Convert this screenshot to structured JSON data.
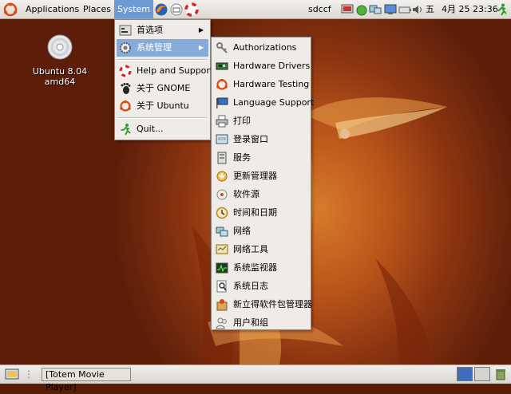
{
  "desktop": {
    "icon_label": "Ubuntu 8.04 amd64"
  },
  "top_panel": {
    "menus": [
      "Applications",
      "Places",
      "System"
    ],
    "username": "sdccf",
    "clock": {
      "weekday": "五",
      "date": "4月 25",
      "time": "23:36"
    }
  },
  "system_menu": {
    "items": [
      {
        "label": "首选项",
        "icon": "preferences-icon",
        "submenu": true
      },
      {
        "label": "系统管理",
        "icon": "gear-icon",
        "submenu": true
      },
      {
        "label": "Help and Support",
        "icon": "help-lifebuoy-icon"
      },
      {
        "label": "关于 GNOME",
        "icon": "gnome-foot-icon"
      },
      {
        "label": "关于 Ubuntu",
        "icon": "ubuntu-logo-icon"
      },
      {
        "label": "Quit...",
        "icon": "quit-running-man-icon"
      }
    ]
  },
  "admin_submenu": {
    "items": [
      {
        "label": "Authorizations",
        "icon": "keys-icon"
      },
      {
        "label": "Hardware Drivers",
        "icon": "hardware-card-icon"
      },
      {
        "label": "Hardware Testing",
        "icon": "ubuntu-logo-icon"
      },
      {
        "label": "Language Support",
        "icon": "flag-icon"
      },
      {
        "label": "打印",
        "icon": "printer-icon"
      },
      {
        "label": "登录窗口",
        "icon": "login-window-icon"
      },
      {
        "label": "服务",
        "icon": "services-icon"
      },
      {
        "label": "更新管理器",
        "icon": "update-manager-icon"
      },
      {
        "label": "软件源",
        "icon": "software-sources-icon"
      },
      {
        "label": "时间和日期",
        "icon": "clock-icon"
      },
      {
        "label": "网络",
        "icon": "network-icon"
      },
      {
        "label": "网络工具",
        "icon": "network-tools-icon"
      },
      {
        "label": "系统监视器",
        "icon": "system-monitor-icon"
      },
      {
        "label": "系统日志",
        "icon": "log-viewer-icon"
      },
      {
        "label": "新立得软件包管理器",
        "icon": "synaptic-icon"
      },
      {
        "label": "用户和组",
        "icon": "users-icon"
      }
    ]
  },
  "bottom_panel": {
    "task_label": "[Totem Movie Player]"
  },
  "colors": {
    "selection": "#86abd9",
    "panel": "#dcd8d2",
    "desktop": "#b9541a"
  }
}
